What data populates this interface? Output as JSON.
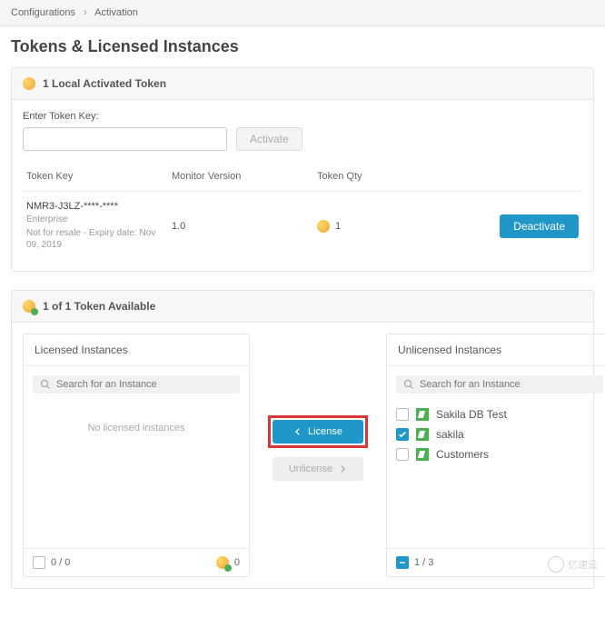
{
  "breadcrumb": {
    "root": "Configurations",
    "current": "Activation"
  },
  "page_title": "Tokens & Licensed Instances",
  "panel1": {
    "header": "1 Local Activated Token",
    "input_label": "Enter Token Key:",
    "activate_btn": "Activate",
    "cols": {
      "key": "Token Key",
      "version": "Monitor Version",
      "qty": "Token Qty"
    },
    "row": {
      "key": "NMR3-J3LZ-****-****",
      "tier": "Enterprise",
      "meta": "Not for resale - Expiry date: Nov 09, 2019",
      "version": "1.0",
      "qty": "1",
      "deactivate": "Deactivate"
    }
  },
  "panel2": {
    "header": "1 of 1 Token Available",
    "licensed": {
      "title": "Licensed Instances",
      "search_ph": "Search for an Instance",
      "empty": "No licensed instances",
      "footer_count": "0 / 0",
      "footer_tokens": "0"
    },
    "transfer": {
      "license": "License",
      "unlicense": "Unlicense"
    },
    "unlicensed": {
      "title": "Unlicensed Instances",
      "search_ph": "Search for an Instance",
      "items": [
        {
          "name": "Sakila DB Test",
          "checked": false
        },
        {
          "name": "sakila",
          "checked": true
        },
        {
          "name": "Customers",
          "checked": false
        }
      ],
      "footer_count": "1 / 3"
    }
  },
  "watermark": "亿速云"
}
